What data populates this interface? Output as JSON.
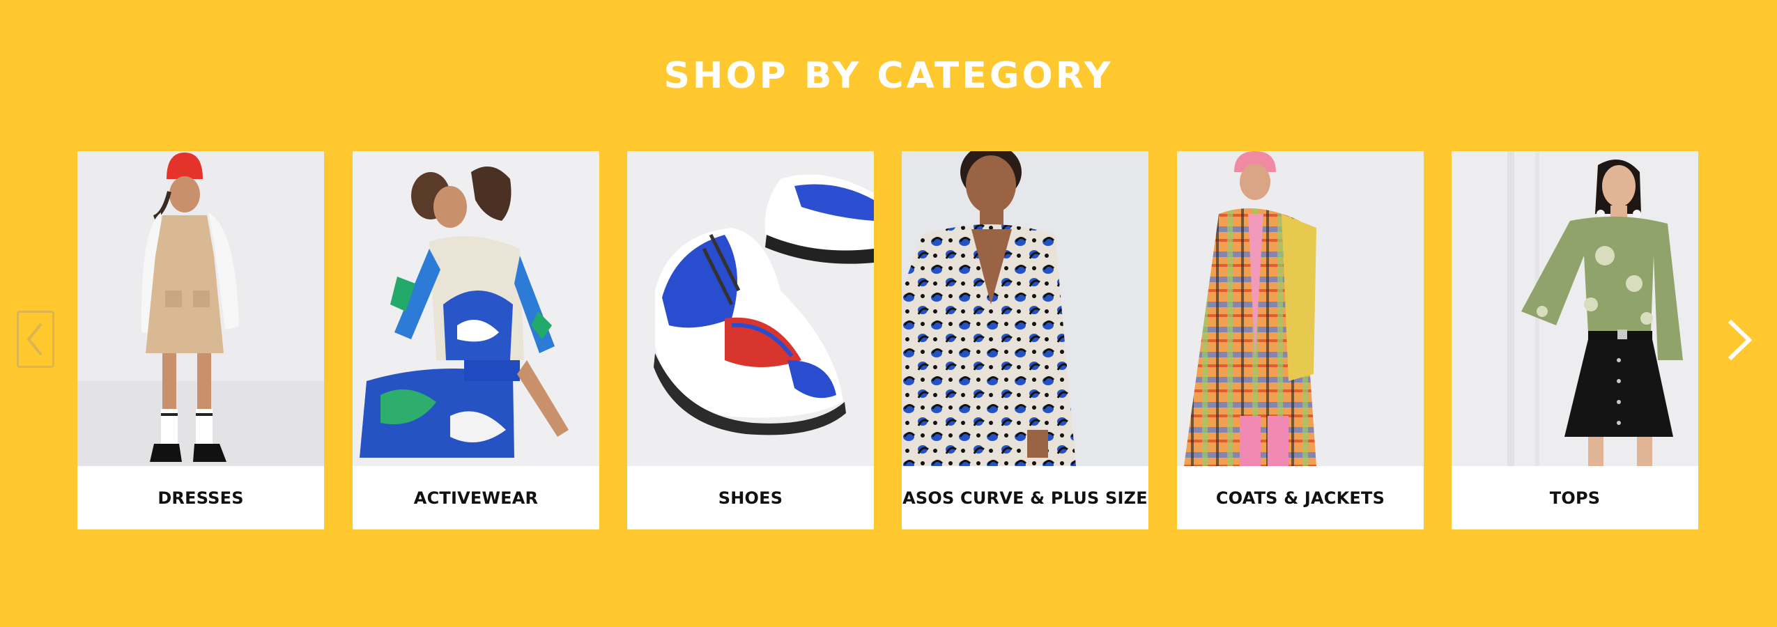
{
  "section": {
    "title": "SHOP BY CATEGORY"
  },
  "carousel": {
    "prev_icon": "chevron-left-icon",
    "next_icon": "chevron-right-icon",
    "categories": [
      {
        "label": "DRESSES"
      },
      {
        "label": "ACTIVEWEAR"
      },
      {
        "label": "SHOES"
      },
      {
        "label": "ASOS CURVE & PLUS SIZE"
      },
      {
        "label": "COATS & JACKETS"
      },
      {
        "label": "TOPS"
      }
    ]
  },
  "colors": {
    "background": "#FFC82E",
    "title": "#FFFFFF",
    "card": "#FFFFFF",
    "label_text": "#111111"
  }
}
